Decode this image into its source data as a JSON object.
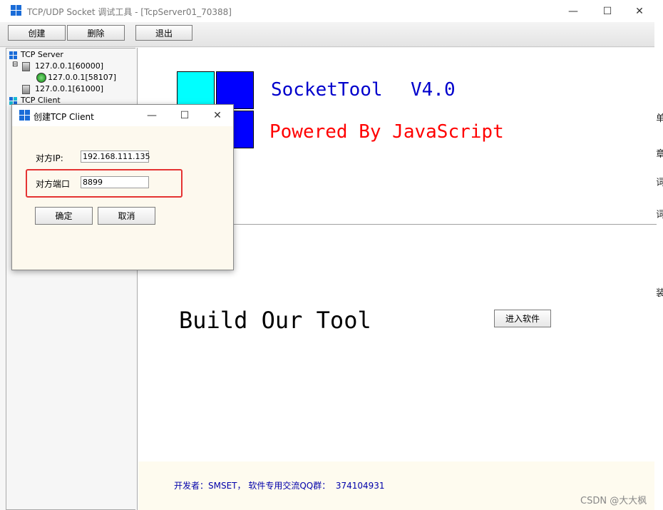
{
  "window": {
    "title": "TCP/UDP Socket 调试工具 - [TcpServer01_70388]",
    "minimize_glyph": "—",
    "maximize_glyph": "☐",
    "close_glyph": "✕"
  },
  "toolbar": {
    "create_label": "创建",
    "delete_label": "删除",
    "exit_label": "退出"
  },
  "tree": {
    "server_root": "TCP Server",
    "server_items": [
      {
        "label": "127.0.0.1[60000]",
        "children": [
          {
            "label": "127.0.0.1[58107]"
          }
        ]
      },
      {
        "label": "127.0.0.1[61000]"
      }
    ],
    "client_root": "TCP Client"
  },
  "content": {
    "app_name": "SocketTool",
    "version": "V4.0",
    "powered_by": "Powered By JavaScript",
    "slogan": "Build Our Tool",
    "enter_button": "进入软件",
    "footer_text": "开发者：SMSET， 软件专用交流QQ群：  374104931",
    "colors": {
      "cyan": "#00ffff",
      "blue": "#0000ff",
      "red": "#ff0000",
      "text_blue": "#0000cc"
    }
  },
  "dialog": {
    "title": "创建TCP Client",
    "ip_label": "对方IP:",
    "ip_value": "192.168.111.135",
    "port_label": "对方端口",
    "port_value": "8899",
    "ok_label": "确定",
    "cancel_label": "取消",
    "minimize_glyph": "—",
    "maximize_glyph": "☐",
    "close_glyph": "✕"
  },
  "watermark": "CSDN @大大枫"
}
